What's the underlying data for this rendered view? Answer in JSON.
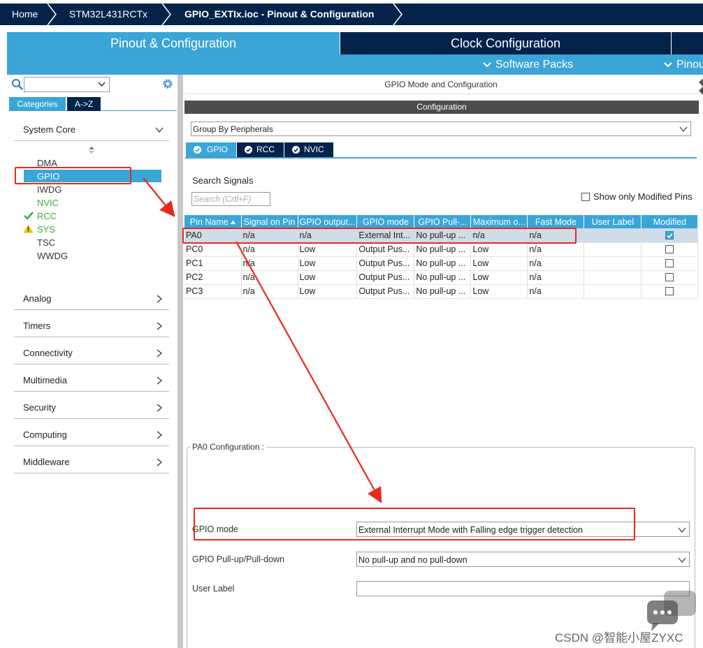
{
  "breadcrumb": {
    "home": "Home",
    "device": "STM32L431RCTx",
    "file": "GPIO_EXTIx.ioc - Pinout & Configuration"
  },
  "tabs": {
    "pinout": "Pinout & Configuration",
    "clock": "Clock Configuration",
    "software_packs": "Software Packs",
    "pinout_sub": "Pinout"
  },
  "left": {
    "search_value": "",
    "cat_tabs": [
      "Categories",
      "A->Z"
    ],
    "system_core": {
      "label": "System Core",
      "items": [
        "DMA",
        "GPIO",
        "IWDG",
        "NVIC",
        "RCC",
        "SYS",
        "TSC",
        "WWDG"
      ]
    },
    "sections": [
      "Analog",
      "Timers",
      "Connectivity",
      "Multimedia",
      "Security",
      "Computing",
      "Middleware"
    ]
  },
  "right": {
    "header": "GPIO Mode and Configuration",
    "config_bar": "Configuration",
    "group_by": "Group By Peripherals",
    "periph_tabs": [
      "GPIO",
      "RCC",
      "NVIC"
    ],
    "search_label": "Search Signals",
    "search_placeholder": "Search (Crtl+F)",
    "show_modified": "Show only Modified Pins",
    "columns": [
      "Pin Name",
      "Signal on Pin",
      "GPIO output...",
      "GPIO mode",
      "GPIO Pull-...",
      "Maximum o...",
      "Fast Mode",
      "User Label",
      "Modified"
    ],
    "rows": [
      {
        "pin": "PA0",
        "signal": "n/a",
        "output": "n/a",
        "mode": "External Int...",
        "pull": "No pull-up ...",
        "max": "n/a",
        "fast": "n/a",
        "label": "",
        "modified": true
      },
      {
        "pin": "PC0",
        "signal": "n/a",
        "output": "Low",
        "mode": "Output Pus...",
        "pull": "No pull-up ...",
        "max": "Low",
        "fast": "n/a",
        "label": "",
        "modified": false
      },
      {
        "pin": "PC1",
        "signal": "n/a",
        "output": "Low",
        "mode": "Output Pus...",
        "pull": "No pull-up ...",
        "max": "Low",
        "fast": "n/a",
        "label": "",
        "modified": false
      },
      {
        "pin": "PC2",
        "signal": "n/a",
        "output": "Low",
        "mode": "Output Pus...",
        "pull": "No pull-up ...",
        "max": "Low",
        "fast": "n/a",
        "label": "",
        "modified": false
      },
      {
        "pin": "PC3",
        "signal": "n/a",
        "output": "Low",
        "mode": "Output Pus...",
        "pull": "No pull-up ...",
        "max": "Low",
        "fast": "n/a",
        "label": "",
        "modified": false
      }
    ],
    "pin_config": {
      "legend": "PA0 Configuration :",
      "gpio_mode_label": "GPIO mode",
      "gpio_mode_value": "External Interrupt Mode with Falling edge trigger detection",
      "pull_label": "GPIO Pull-up/Pull-down",
      "pull_value": "No pull-up and no pull-down",
      "user_label": "User Label",
      "user_label_value": ""
    }
  },
  "watermark": "CSDN @智能小屋ZYXC",
  "colors": {
    "navy": "#03234b",
    "accent": "#3aa5d6",
    "highlight": "#e8291c",
    "ok_green": "#3aaa3a",
    "warn_yellow": "#f2c200"
  }
}
